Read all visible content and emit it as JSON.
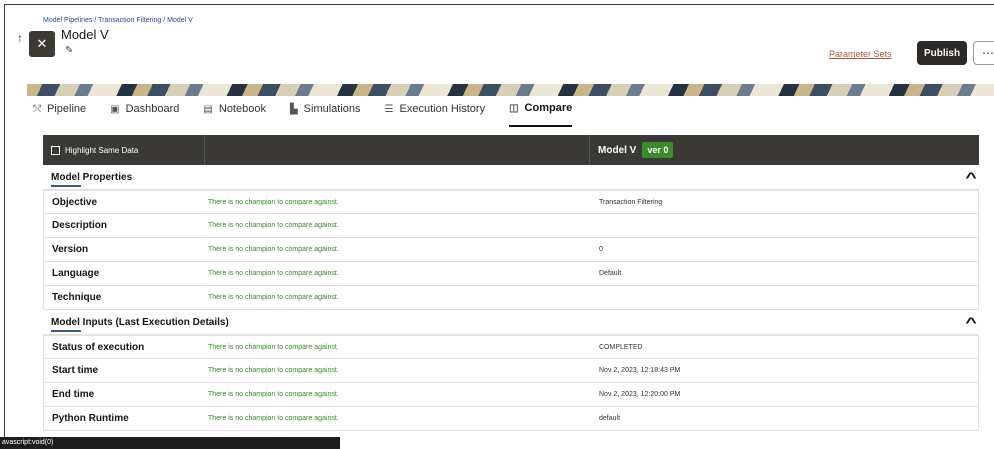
{
  "breadcrumb": [
    "Model Pipelines",
    "Transaction Filtering",
    "Model V"
  ],
  "breadcrumb_sep": " / ",
  "header": {
    "title": "Model V",
    "parameter_sets_label": "Parameter Sets",
    "publish_label": "Publish",
    "more_label": "⋯",
    "up_icon": "↑",
    "edit_icon": "✎",
    "app_icon": "✕"
  },
  "tabs": [
    {
      "label": "Pipeline",
      "icon": "⤲"
    },
    {
      "label": "Dashboard",
      "icon": "▣"
    },
    {
      "label": "Notebook",
      "icon": "▤"
    },
    {
      "label": "Simulations",
      "icon": "▙"
    },
    {
      "label": "Execution History",
      "icon": "☰"
    },
    {
      "label": "Compare",
      "icon": "◫"
    }
  ],
  "table": {
    "highlight_label": "Highlight Same Data",
    "model_name": "Model V",
    "version_badge": "ver 0",
    "sections": [
      {
        "title": "Model Properties",
        "rows": [
          {
            "key": "Objective",
            "champion": "There is no champion to compare against.",
            "value": "Transaction Filtering"
          },
          {
            "key": "Description",
            "champion": "There is no champion to compare against.",
            "value": ""
          },
          {
            "key": "Version",
            "champion": "There is no champion to compare against.",
            "value": "0"
          },
          {
            "key": "Language",
            "champion": "There is no champion to compare against.",
            "value": "Default"
          },
          {
            "key": "Technique",
            "champion": "There is no champion to compare against.",
            "value": ""
          }
        ]
      },
      {
        "title": "Model Inputs (Last Execution Details)",
        "rows": [
          {
            "key": "Status of execution",
            "champion": "There is no champion to compare against.",
            "value": "COMPLETED"
          },
          {
            "key": "Start time",
            "champion": "There is no champion to compare against.",
            "value": "Nov 2, 2023, 12:18:43 PM"
          },
          {
            "key": "End time",
            "champion": "There is no champion to compare against.",
            "value": "Nov 2, 2023, 12:20:00 PM"
          },
          {
            "key": "Python Runtime",
            "champion": "There is no champion to compare against.",
            "value": "default"
          }
        ]
      }
    ]
  },
  "statusbar": {
    "text": "avascript:void(0)"
  },
  "colors": {
    "accent": "#3c8a2e",
    "header_bg": "#3b3936",
    "link": "#b5563a"
  }
}
